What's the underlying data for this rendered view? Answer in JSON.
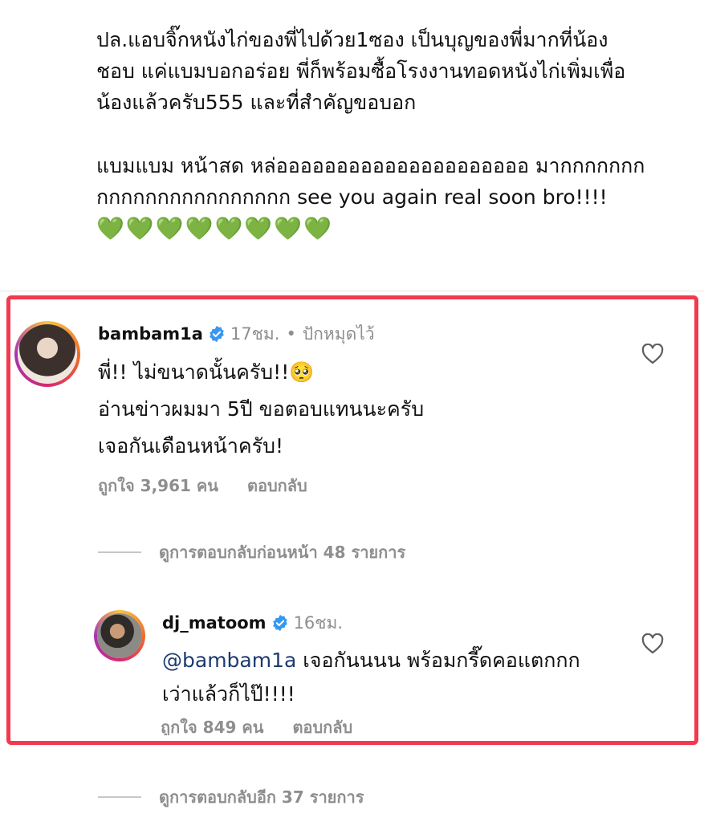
{
  "post": {
    "caption_lines": [
      "ปล.แอบจิ๊กหนังไก่ของพี่ไปด้วย1ซอง เป็นบุญของพี่มากที่น้อง",
      "ชอบ แค่แบมบอกอร่อย พี่ก็พร้อมซื้อโรงงานทอดหนังไก่เพิ่มเพื่อ",
      "น้องแล้วครับ555 และที่สำคัญขอบอก",
      "",
      "แบมแบม หน้าสด หล่อออออออออออออออออออออ มากกกกกกก",
      "กกกกกกกกกกกกกกกก see you again real soon bro!!!!"
    ],
    "hearts": "💚💚💚💚💚💚💚💚"
  },
  "comment1": {
    "username": "bambam1a",
    "time": "17ชม.",
    "separator": "•",
    "pinned": "ปักหมุดไว้",
    "lines": [
      "พี่!! ไม่ขนาดนั้นครับ!!🥺",
      "อ่านข่าวผมมา 5ปี ขอตอบแทนนะครับ",
      "เจอกันเดือนหน้าครับ!"
    ],
    "likes": "ถูกใจ 3,961 คน",
    "reply": "ตอบกลับ",
    "view_previous": "ดูการตอบกลับก่อนหน้า 48 รายการ"
  },
  "reply1": {
    "username": "dj_matoom",
    "time": "16ชม.",
    "mention": "@bambam1a",
    "line1": " เจอกันนนน พร้อมกรี๊ดคอแตกกก",
    "line2": "เว่าแล้วก็ไป๊!!!!",
    "likes": "ถูกใจ 849 คน",
    "reply": "ตอบกลับ"
  },
  "more_replies": "ดูการตอบกลับอีก 37 รายการ",
  "colors": {
    "highlight": "#f4394f",
    "verified": "#3797f0",
    "muted": "#8e8e8e"
  }
}
